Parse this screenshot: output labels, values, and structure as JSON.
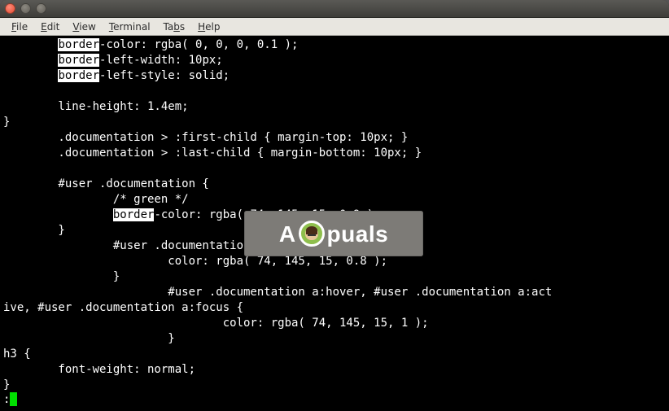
{
  "menubar": {
    "file": "File",
    "edit": "Edit",
    "view": "View",
    "terminal": "Terminal",
    "tabs": "Tabs",
    "help": "Help"
  },
  "search_highlight": "border",
  "code": {
    "l1_a": "        ",
    "l1_b": "-color: rgba( 0, 0, 0, 0.1 );",
    "l2_a": "        ",
    "l2_b": "-left-width: 10px;",
    "l3_a": "        ",
    "l3_b": "-left-style: solid;",
    "l4": "",
    "l5": "        line-height: 1.4em;",
    "l6": "}",
    "l7": "        .documentation > :first-child { margin-top: 10px; }",
    "l8": "        .documentation > :last-child { margin-bottom: 10px; }",
    "l9": "",
    "l10": "        #user .documentation {",
    "l11": "                /* green */",
    "l12_a": "                ",
    "l12_b": "-color: rgba( 74, 145, 15, 0.9 );",
    "l13": "        }",
    "l14": "                #user .documentation a {",
    "l15": "                        color: rgba( 74, 145, 15, 0.8 );",
    "l16": "                }",
    "l17": "                        #user .documentation a:hover, #user .documentation a:act",
    "l18": "ive, #user .documentation a:focus {",
    "l19": "                                color: rgba( 74, 145, 15, 1 );",
    "l20": "                        }",
    "l21": "h3 {",
    "l22": "        font-weight: normal;",
    "l23": "}"
  },
  "status_prefix": ":",
  "watermark_text_a": "A",
  "watermark_text_b": "puals"
}
